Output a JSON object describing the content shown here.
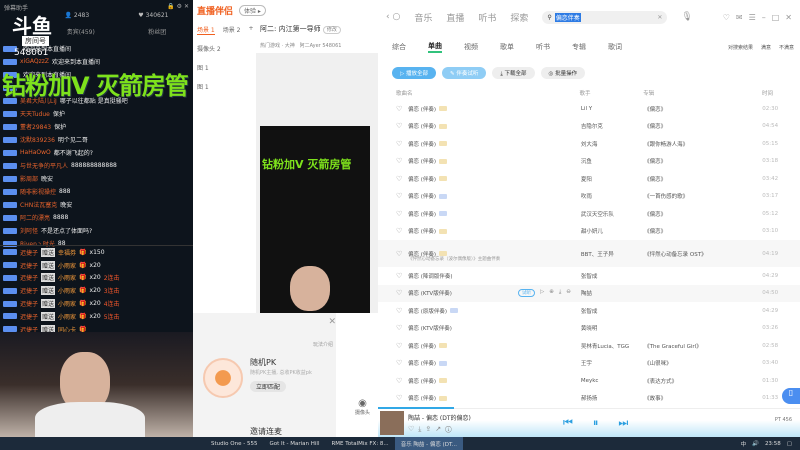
{
  "chat_panel": {
    "title": "弹幕助手",
    "stat_users": "2483",
    "stat_likes": "340621",
    "tab_vip": "贵宾(459)",
    "tab_fans": "粉丝团",
    "logo": "斗鱼",
    "logo_sub": "房间号",
    "room_id": "548061",
    "overlay_text": "钻粉加V 灭箭房管",
    "messages": [
      {
        "nick": "",
        "msg": "欢迎来到本直播间"
      },
      {
        "nick": "xiGAQzzZ",
        "msg": "欢迎来到本直播间"
      },
      {
        "nick": "",
        "msg": "欢迎来到本直播间"
      },
      {
        "nick": "",
        "msg": ""
      },
      {
        "nick": "吴君大陆儿LiJ",
        "msg": "哪子以往都贴 是真挺骚吧"
      },
      {
        "nick": "天天Tudue",
        "msg": "保护"
      },
      {
        "nick": "董者29843",
        "msg": "保护"
      },
      {
        "nick": "沈默839236",
        "msg": "明个见二哥"
      },
      {
        "nick": "HaHaOwO",
        "msg": "都不谢飞起的?"
      },
      {
        "nick": "与世无争的平凡人",
        "msg": "888888888888"
      },
      {
        "nick": "影周部",
        "msg": "晚安"
      },
      {
        "nick": "随非影视操控",
        "msg": "888"
      },
      {
        "nick": "CHN法瓦塞克",
        "msg": "晚安"
      },
      {
        "nick": "阿二的漂亮",
        "msg": "8888"
      },
      {
        "nick": "刘阿怪",
        "msg": "不是还点了体面吗?"
      },
      {
        "nick": "Riven丶时光",
        "msg": "88"
      }
    ],
    "gifts": [
      {
        "nick": "迟捷子",
        "action": "赠送",
        "gift": "幸福券",
        "count": "x150",
        "combo": ""
      },
      {
        "nick": "迟捷子",
        "action": "赠送",
        "gift": "小雨家",
        "count": "x20",
        "combo": ""
      },
      {
        "nick": "迟捷子",
        "action": "赠送",
        "gift": "小雨家",
        "count": "x20",
        "combo": "2连击"
      },
      {
        "nick": "迟捷子",
        "action": "赠送",
        "gift": "小雨家",
        "count": "x20",
        "combo": "3连击"
      },
      {
        "nick": "迟捷子",
        "action": "赠送",
        "gift": "小雨家",
        "count": "x20",
        "combo": "4连击"
      },
      {
        "nick": "迟捷子",
        "action": "赠送",
        "gift": "小雨家",
        "count": "x20",
        "combo": "5连击"
      },
      {
        "nick": "迟捷子",
        "action": "赠送",
        "gift": "同心卡",
        "count": "",
        "combo": ""
      }
    ]
  },
  "streamer_tool": {
    "app_name": "直播伴侣",
    "version": "体验 ▸",
    "scenes": [
      "场景 1",
      "场景 2"
    ],
    "add": "+",
    "sources": [
      "摄像头 2",
      "图 1",
      "图 1"
    ],
    "room_title": "阿二: 内江第一导师",
    "edit": "修改",
    "category": "热门游戏 · 大神",
    "anchor": "阿二Ayer",
    "room_no": "548061",
    "pk": {
      "intro": "玩法介绍",
      "title": "随机PK",
      "desc": "随机PK主播, 总收PK收益pk",
      "match": "立即匹配",
      "invite": "邀请连麦",
      "camera": "摄像头"
    }
  },
  "music": {
    "nav": [
      "音乐",
      "直播",
      "听书",
      "探索"
    ],
    "search": "偏恋伴奏",
    "tabs": [
      "综合",
      "单曲",
      "视频",
      "歌单",
      "听书",
      "专辑",
      "歌词"
    ],
    "active_tab": 1,
    "filters": [
      "对搜索结果",
      "满意",
      "不满意"
    ],
    "actions": [
      "▷ 播放全部",
      "✎ 伴奏试听",
      "⤓ 下载全部",
      "◎ 批量操作"
    ],
    "columns": [
      "歌曲名",
      "歌手",
      "专辑",
      "时间"
    ],
    "songs": [
      {
        "title": "偏恋 (伴奏)",
        "tag": "y",
        "artist": "Lil Y",
        "album": "《偏恋》",
        "time": "02:30"
      },
      {
        "title": "偏恋 (伴奏)",
        "tag": "y",
        "artist": "吉隐尔克",
        "album": "《偏恋》",
        "time": "04:54"
      },
      {
        "title": "偏恋 (伴奏)",
        "tag": "y",
        "artist": "刘大海",
        "album": "《跟你畅游人海》",
        "time": "05:15"
      },
      {
        "title": "偏恋 (伴奏)",
        "tag": "y",
        "artist": "沉鱼",
        "album": "《偏恋》",
        "time": "03:18"
      },
      {
        "title": "偏恋 (伴奏)",
        "tag": "y",
        "artist": "夏阳",
        "album": "《偏恋》",
        "time": "03:42"
      },
      {
        "title": "偏恋 (伴奏)",
        "tag": "b",
        "artist": "吹雨",
        "album": "《一首伤感的歌》",
        "time": "03:17"
      },
      {
        "title": "偏恋 (伴奏)",
        "tag": "b",
        "artist": "武汉天空乐队",
        "album": "《偏恋》",
        "time": "05:12"
      },
      {
        "title": "偏恋 (伴奏)",
        "tag": "y",
        "artist": "甜小妍儿",
        "album": "《偏恋》",
        "time": "03:10"
      },
      {
        "title": "偏恋 (伴奏)",
        "tag": "y",
        "artist": "BBT、王子异",
        "album": "《怦然心动备忘录 OST》",
        "time": "04:19",
        "sub": "《怦然心动备忘录（波尔偶像版）》主题曲伴奏"
      },
      {
        "title": "偏恋 (降调版伴奏)",
        "tag": "",
        "artist": "张智成",
        "album": "",
        "time": "04:29"
      },
      {
        "title": "偏恋 (KTV版伴奏)",
        "tag": "",
        "artist": "陶喆",
        "album": "",
        "time": "04:50",
        "hover": true
      },
      {
        "title": "偏恋 (原版伴奏)",
        "tag": "b",
        "artist": "张智成",
        "album": "",
        "time": "04:29"
      },
      {
        "title": "偏恋 (KTV版伴奏)",
        "tag": "",
        "artist": "黄晓明",
        "album": "",
        "time": "03:26"
      },
      {
        "title": "偏恋 (伴奏)",
        "tag": "y",
        "artist": "吴林青Lucia、TGG",
        "album": "《The Graceful Girl》",
        "time": "02:58"
      },
      {
        "title": "偏恋 (伴奏)",
        "tag": "b",
        "artist": "王宇",
        "album": "《山很咪》",
        "time": "03:40"
      },
      {
        "title": "偏恋 (伴奏)",
        "tag": "y",
        "artist": "Meykc",
        "album": "《表达方式》",
        "time": "01:30"
      },
      {
        "title": "偏恋 (伴奏)",
        "tag": "y",
        "artist": "郝扬扬",
        "album": "《故事》",
        "time": "01:33"
      }
    ],
    "hover_try": "试听",
    "player": {
      "now_playing": "陶喆 - 偏恋 (DT的偏恋)",
      "quality": "PT 456",
      "progress": 0.18
    }
  },
  "taskbar": {
    "items": [
      "Studio One - 555",
      "Got It - Marian Hill",
      "RME TotalMix FX: 8...",
      "音乐 陶喆 - 偏恋 (DT..."
    ],
    "active": 3,
    "clock": "23:58",
    "ime": "中"
  }
}
